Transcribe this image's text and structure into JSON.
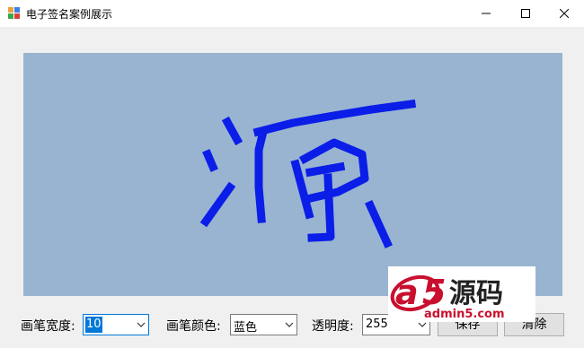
{
  "window": {
    "title": "电子签名案例展示",
    "minimize_glyph": "—",
    "maximize_glyph": "☐",
    "close_glyph": "✕"
  },
  "signature": {
    "stroke_color": "#0a1ee8",
    "background": "#99b4d1"
  },
  "controls": {
    "pen_width_label": "画笔宽度:",
    "pen_width_value": "10",
    "pen_color_label": "画笔颜色:",
    "pen_color_value": "蓝色",
    "opacity_label": "透明度:",
    "opacity_value": "255",
    "save_label": "保存",
    "clear_label": "清除"
  },
  "watermark": {
    "brand_a": "a",
    "brand_5": "5",
    "brand_cn": "源码",
    "domain": "admin5.com"
  }
}
